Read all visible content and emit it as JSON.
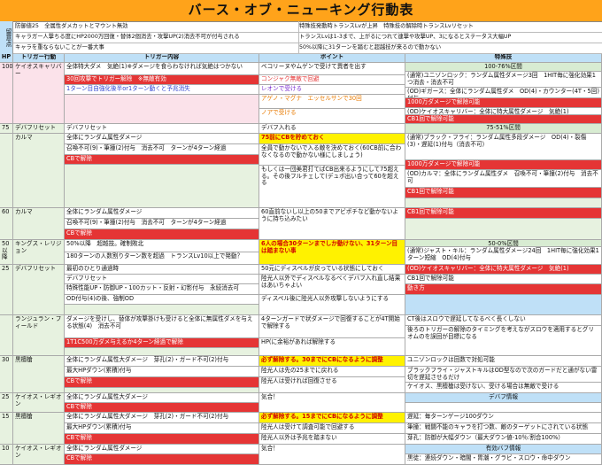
{
  "title": "バース・オブ・ニューキング行動表",
  "notes": {
    "header": "留意点",
    "lines": [
      "防御値25　全属性ダメカットとマウント無効",
      "特殊技発動時トランスLvが上昇　特殊技の解除時トランスLvリセット",
      "キャラガー人撃ちる度にHP2000万回復・替体2個消去・攻撃UP(2)消去不可が付与される",
      "トランスLvは1-3まで、上がるにつれて連撃や攻撃UP、3になるとステータス大幅UP",
      "キャラを重ならないことが一番大事",
      "50%以降に31ターンを踏むと超越技が来るので動かない"
    ]
  },
  "headers": {
    "hp": "HP",
    "trigger": "トリガー行動",
    "content": "トリガー内容",
    "point": "ポイント",
    "special": "特殊技"
  },
  "rows": [
    {
      "hp": "100",
      "trigger": "ケイオスキャリバー",
      "content": [
        "全体特大ダメ　気絶(1)※ダメージを食らわなければ気絶はつかない",
        "30回攻撃でトリガー解除　※無敵有効",
        "1ターン目自強化後半or1ターン動くと予兆消失"
      ],
      "point": [
        "ベコリーヌやムゲンで受けて異者を出す",
        "コンジャク無敵で回避",
        "レオンで受ける",
        "アゲノ・マグナ　エッセルサンで30回",
        "ノアで受ける"
      ],
      "special": [
        "100-76%区間",
        "(通常)ユニゾンロック：ランダム属性ダメージ3回　1HIT毎に強化効果1つ消去・消去不可",
        "(OD)ギガース：全体にランダム属性ダメ　OD(4)・カウンター(4T・5回)付与",
        "1000万ダメージで解除可能",
        "(OD)ケイオスキャリバー：全体に特大属性ダメージ　気絶(1)",
        "CB1回で解除可能"
      ]
    },
    {
      "hp": "75",
      "trigger": "デバフリセット",
      "content": [
        "デバフリセット"
      ],
      "point": [
        "デバフ入れる"
      ],
      "special": [
        "75-51%区間"
      ]
    },
    {
      "hp": "",
      "trigger": "カルマ",
      "content": [
        "全体にランダム属性ダメージ",
        "召喚不可(9)・筆撞(2)付与　消去不可　ターンが4ターン経過",
        "CBで解除"
      ],
      "point": [
        "75前にCBを貯めておく",
        "全員で動かないで入る敵を決めておく(60CB前に合わなくなるので動かない様にしましょう)",
        "もしくは一団美君打てばCB出来るようにして75超える。その後フルチェして(デュポ出い合って60を超える"
      ],
      "special": [
        "(通常)ブラック・フライ：ランダム属性多段ダメージ　OD(4)・裂傷(3)・遅延(1)付与（消去不可）",
        "1000万ダメージで解除可能",
        "(OD)カルマ：全体にランダム属性ダメ　召喚不可・筆撞(2)付与　消去不可",
        "CB1回で解除可能"
      ]
    },
    {
      "hp": "60",
      "trigger": "カルマ",
      "content": [
        "全体にランダム属性ダメージ",
        "召喚不可(9)・筆撞(2)付与　消去不可　ターンが4ターン経過",
        "CBで解除"
      ],
      "point": [
        "60直前ないし以上の50までアビポチなど動かないように持ち込みたい"
      ],
      "special": [
        "CB1回で解除可能"
      ]
    },
    {
      "hp": "50以降",
      "trigger": "キングス・レリジョン",
      "content": [
        "50%以降　超越技。確制敗北",
        "180ターンの人数割りターン数を超過　トランスLv10以上で発動？"
      ],
      "point": [
        "6人の場合30ターンまでしか動けない、31ターン目は踏まない事"
      ],
      "special": [
        "50-0%区間",
        "(通常)ジャスト・キル：ランダム属性ダメージ24回　1HIT毎に強化効果1ターン短縮　OD(4)付与",
        "1000万ダメージで解除可能"
      ]
    },
    {
      "hp": "25",
      "trigger": "デバフリセット",
      "content": [
        "最初のひとり通過時",
        "デバフリセット",
        "特殊性能UP・防御UP・100カット・反射・幻影付与　永続消去可",
        "OD付与(4)の後、強制OD"
      ],
      "point": [
        "50元にディスペルが戻っている状態にしておく",
        "陸光人以外でディスペルなるべくデバフ入れ直し結果はあいちゃよい",
        "ディスペル後に陸光人以外攻撃しないようにする"
      ],
      "special": [
        "(OD)ケイオスキャリバー：全体に特大属性ダメージ　気絶(1)",
        "CB1回で解除可能",
        "動き方"
      ]
    },
    {
      "hp": "",
      "trigger": "ランジュラン・フィールド",
      "content": [
        "ダメージを受けし、替体が攻撃掛けも受けると全体に無属性ダメを与える状態(4)　消去不可",
        "1T1C500万ダメ与えるか4ターン経過で解除"
      ],
      "point": [
        "4ターンガードで状ダメージで回復することが4T開始で解除する",
        "HP(に余裕があれば解除する"
      ],
      "special": [
        "CT後はスロウで遅延してなるべく長くしない",
        "後ろのトリガーの解除のタイミングを考えながスロウを適用するとグリオムのを誤回が目標になる"
      ]
    },
    {
      "hp": "30",
      "trigger": "黒檀槍",
      "content": [
        "全体にランダム属性大ダメージ　芽孔(2)・ガード不可(2)付与",
        "最大HPダウン(累積)付与",
        "CBで解除"
      ],
      "point": [
        "必ず解除する。30までにCBになるように調整",
        "陸光人は先の25までに戻れる",
        "陸光人は受ければ回復させる"
      ],
      "special": [
        "ユニゾンロックは回数で対処可能",
        "ブラックフライ・ジャストキルはOD型なので次のガードだと通がない雷切を遅延させるだけ",
        "ケイオス、黒檀槍は受けない、受ける場合は無敵で受ける"
      ]
    },
    {
      "hp": "25",
      "trigger": "ケイオス・レギオン",
      "content": [
        "全体にランダム属性大ダメージ",
        "CBで解除"
      ],
      "point": [
        "気合！"
      ],
      "special": [
        "デバフ情報"
      ]
    },
    {
      "hp": "15",
      "trigger": "黒檀槍",
      "content": [
        "全体にランダム属性大ダメージ　芽孔(2)・ガード不可(2)付与",
        "最大HPダウン(累積)付与",
        "CBで解除"
      ],
      "point": [
        "必ず解除する。15までにCBになるように調整",
        "陸光人は受けて調査可能で回避する",
        "陸光人以外は予兆を踏まない"
      ],
      "special": [
        "遅延：毎ターンゲージ100ダウン",
        "筆撞：戦闘不能のキャラを打つ数、敵のターゲットにされている状態",
        "芽孔：防御が大幅ダウン（最大ダウン値-10％:割合100%）"
      ]
    },
    {
      "hp": "10",
      "trigger": "ケイオス・レギオン",
      "content": [
        "全体にランダム属性ダメージ",
        "CBで解除"
      ],
      "point": [
        "気合！"
      ],
      "special": [
        "有効バフ情報",
        "黒徒：連続ダウン・暗闇・胃潮・グラビ・スロウ・命中ダウン"
      ]
    }
  ]
}
